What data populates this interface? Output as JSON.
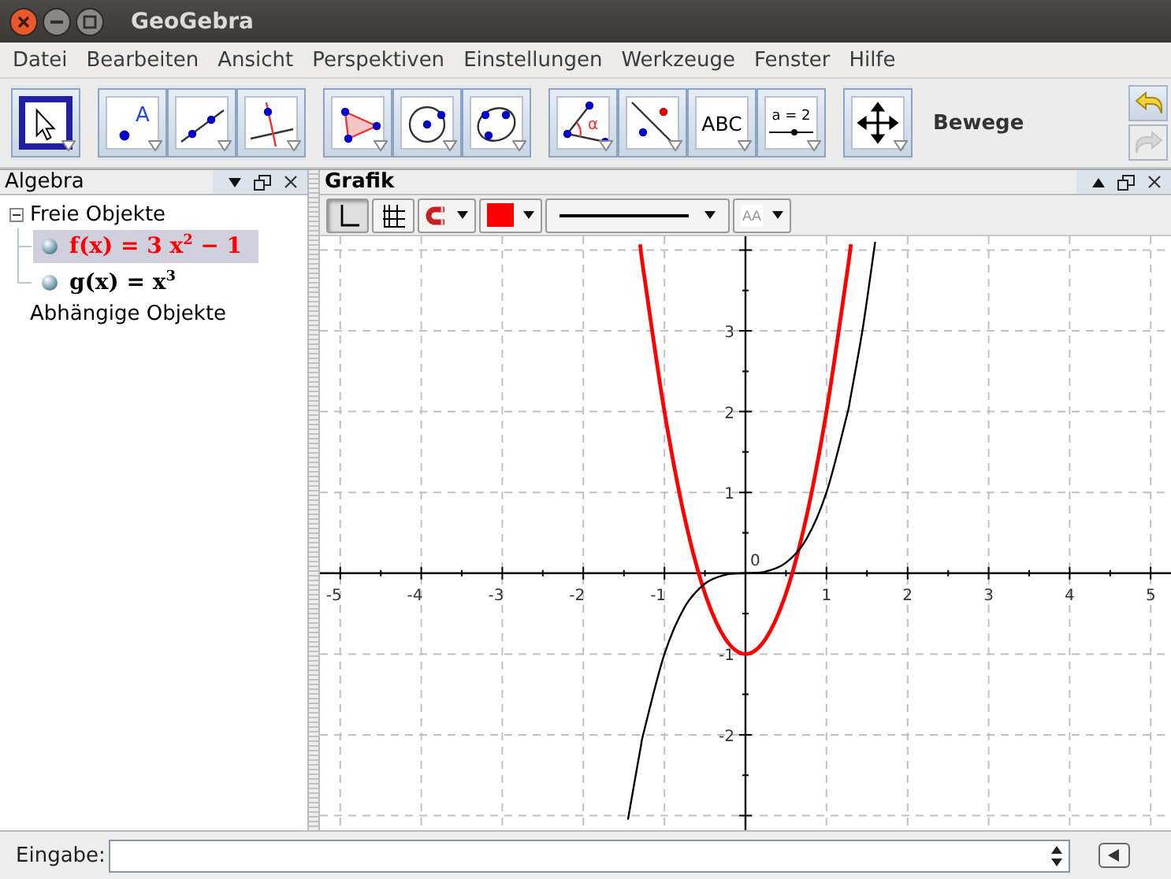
{
  "window": {
    "title": "GeoGebra"
  },
  "menu": [
    "Datei",
    "Bearbeiten",
    "Ansicht",
    "Perspektiven",
    "Einstellungen",
    "Werkzeuge",
    "Fenster",
    "Hilfe"
  ],
  "toolbar": {
    "groups": [
      {
        "tools": [
          {
            "kind": "move",
            "selected": true
          }
        ]
      },
      {
        "tools": [
          {
            "kind": "point",
            "label": "A",
            "selected": false
          },
          {
            "kind": "line",
            "selected": false
          },
          {
            "kind": "perpendicular",
            "selected": false
          }
        ]
      },
      {
        "tools": [
          {
            "kind": "polygon",
            "selected": false
          },
          {
            "kind": "circle",
            "selected": false
          },
          {
            "kind": "conic",
            "selected": false
          }
        ]
      },
      {
        "tools": [
          {
            "kind": "angle",
            "label": "α",
            "selected": false
          },
          {
            "kind": "reflect",
            "selected": false
          },
          {
            "kind": "text",
            "label": "ABC",
            "selected": false
          },
          {
            "kind": "slider",
            "label": "a = 2",
            "selected": false
          }
        ]
      },
      {
        "tools": [
          {
            "kind": "pan",
            "selected": false
          }
        ]
      }
    ],
    "tool_name": "Bewege"
  },
  "algebra": {
    "title": "Algebra",
    "groups": [
      {
        "label": "Freie Objekte",
        "expanded": true,
        "items": [
          {
            "formula": "f(x) = 3 x$^{2}$ − 1",
            "color": "#ff0000",
            "selected": true
          },
          {
            "formula": "g(x) = x$^{3}$",
            "color": "#000000",
            "selected": false
          }
        ]
      },
      {
        "label": "Abhängige Objekte"
      }
    ]
  },
  "graphics": {
    "title": "Grafik",
    "style_bar": [
      {
        "kind": "axes",
        "selected": true
      },
      {
        "kind": "grid",
        "selected": false
      },
      {
        "kind": "capture"
      },
      {
        "kind": "color",
        "color": "#ff0000"
      },
      {
        "kind": "line-style"
      },
      {
        "kind": "label-style",
        "label": "AA"
      }
    ],
    "chart_data": {
      "type": "line",
      "x": [
        -1.45,
        -1.3,
        -1.25,
        -1,
        -0.75,
        -0.5,
        -0.25,
        0,
        0.25,
        0.5,
        0.75,
        1,
        1.25,
        1.3,
        1.45,
        1.6
      ],
      "series": [
        {
          "color": "#ff0000",
          "values": [
            null,
            4.07,
            3.69,
            2,
            0.69,
            -0.25,
            -0.81,
            -1,
            -0.81,
            -0.25,
            0.69,
            2,
            3.69,
            4.07,
            null,
            null
          ]
        },
        {
          "color": "#000000",
          "values": [
            -3.05,
            -2.2,
            -1.95,
            -1,
            -0.42,
            -0.13,
            -0.02,
            0,
            0.02,
            0.13,
            0.42,
            1,
            1.95,
            2.2,
            3.05,
            4.1
          ]
        }
      ],
      "xlim": [
        -5.25,
        5.25
      ],
      "ylim": [
        -3.2,
        4.17
      ],
      "grid": true,
      "xticks": [
        -5,
        -4,
        -3,
        -2,
        -1,
        1,
        2,
        3,
        4,
        5
      ],
      "yticks": [
        -2,
        -1,
        1,
        2,
        3
      ]
    },
    "origin_label": "0"
  },
  "input_bar": {
    "label": "Eingabe:"
  }
}
